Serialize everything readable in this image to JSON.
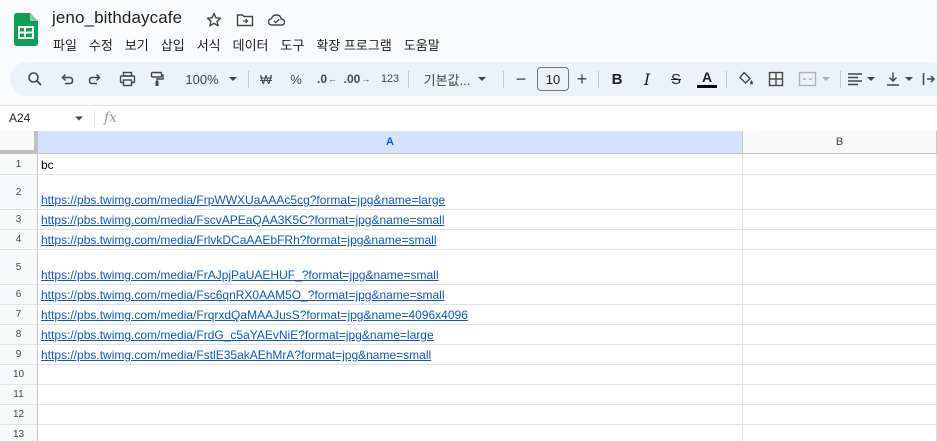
{
  "document": {
    "title": "jeno_bithdaycafe"
  },
  "menu": [
    "파일",
    "수정",
    "보기",
    "삽입",
    "서식",
    "데이터",
    "도구",
    "확장 프로그램",
    "도움말"
  ],
  "toolbar": {
    "zoom": "100%",
    "currency": "₩",
    "percent": "%",
    "decimal_decrease": ".0",
    "decimal_increase": ".00",
    "number_format": "123",
    "font": "기본값...",
    "font_size": "10",
    "bold": "B",
    "italic": "I",
    "strike": "S",
    "text_color": "A"
  },
  "formula_bar": {
    "cell_ref": "A24",
    "fx": "fx",
    "value": ""
  },
  "grid": {
    "columns": [
      "A",
      "B"
    ],
    "rows": [
      {
        "n": "1",
        "a": "bc",
        "link": false
      },
      {
        "n": "2",
        "a": "https://pbs.twimg.com/media/FrpWWXUaAAAc5cg?format=jpg&name=large",
        "link": true
      },
      {
        "n": "3",
        "a": "https://pbs.twimg.com/media/FscvAPEaQAA3K5C?format=jpg&name=small",
        "link": true
      },
      {
        "n": "4",
        "a": "https://pbs.twimg.com/media/FrlvkDCaAAEbFRh?format=jpg&name=small",
        "link": true
      },
      {
        "n": "5",
        "a": "https://pbs.twimg.com/media/FrAJpjPaUAEHUF_?format=jpg&name=small",
        "link": true
      },
      {
        "n": "6",
        "a": "https://pbs.twimg.com/media/Fsc6qnRX0AAM5O_?format=jpg&name=small",
        "link": true
      },
      {
        "n": "7",
        "a": "https://pbs.twimg.com/media/FrqrxdQaMAAJusS?format=jpg&name=4096x4096",
        "link": true
      },
      {
        "n": "8",
        "a": "https://pbs.twimg.com/media/FrdG_c5aYAEvNiE?format=jpg&name=large",
        "link": true
      },
      {
        "n": "9",
        "a": "https://pbs.twimg.com/media/FstlE35akAEhMrA?format=jpg&name=small",
        "link": true
      },
      {
        "n": "10",
        "a": "",
        "link": false
      },
      {
        "n": "11",
        "a": "",
        "link": false
      },
      {
        "n": "12",
        "a": "",
        "link": false
      },
      {
        "n": "13",
        "a": "",
        "link": false
      }
    ]
  },
  "colors": {
    "sheets_green": "#0f9d58",
    "link": "#1155cc",
    "selected_header": "#d3e3fd",
    "toolbar_bg": "#edf2fa"
  },
  "icons": [
    "sheets-logo",
    "star-icon",
    "move-folder-icon",
    "cloud-saved-icon",
    "search-icon",
    "undo-icon",
    "redo-icon",
    "print-icon",
    "paint-format-icon",
    "fill-color-icon",
    "borders-icon",
    "merge-cells-icon",
    "align-left-icon",
    "valign-bottom-icon",
    "text-wrap-icon"
  ]
}
